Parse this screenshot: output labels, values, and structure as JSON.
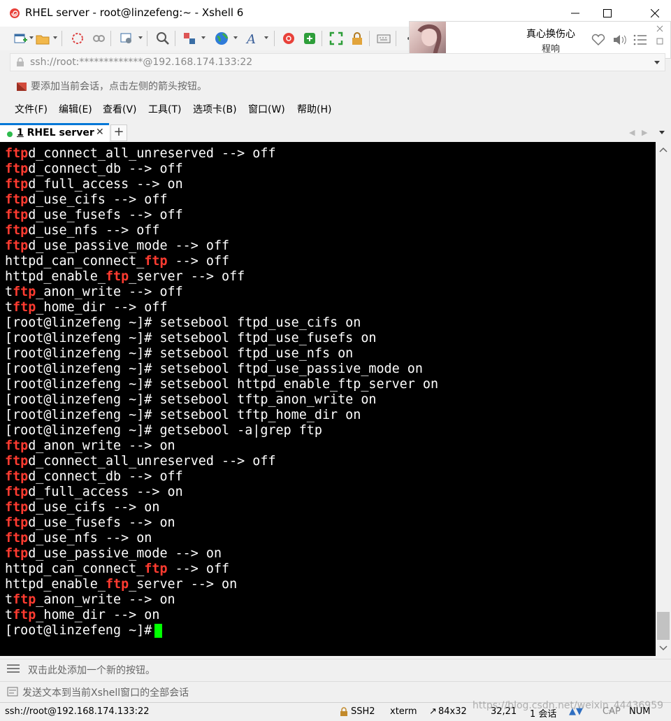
{
  "window": {
    "title": "RHEL server - root@linzefeng:~ - Xshell 6",
    "minimize_glyph": "—",
    "maximize_glyph": "☐",
    "close_glyph": "✕"
  },
  "music_player": {
    "song": "真心换伤心",
    "artist": "程响"
  },
  "address_bar": {
    "value": "ssh://root:*************@192.168.174.133:22"
  },
  "hint_bar": {
    "text": "要添加当前会话，点击左侧的箭头按钮。"
  },
  "menu": {
    "items": [
      "文件(F)",
      "编辑(E)",
      "查看(V)",
      "工具(T)",
      "选项卡(B)",
      "窗口(W)",
      "帮助(H)"
    ]
  },
  "tabs": {
    "active_number": "1",
    "active_label": " RHEL server",
    "close_glyph": "✕",
    "add_glyph": "+"
  },
  "terminal": {
    "lines": [
      [
        [
          "ftp",
          true
        ],
        [
          "d_connect_all_unreserved --> off",
          false
        ]
      ],
      [
        [
          "ftp",
          true
        ],
        [
          "d_connect_db --> off",
          false
        ]
      ],
      [
        [
          "ftp",
          true
        ],
        [
          "d_full_access --> on",
          false
        ]
      ],
      [
        [
          "ftp",
          true
        ],
        [
          "d_use_cifs --> off",
          false
        ]
      ],
      [
        [
          "ftp",
          true
        ],
        [
          "d_use_fusefs --> off",
          false
        ]
      ],
      [
        [
          "ftp",
          true
        ],
        [
          "d_use_nfs --> off",
          false
        ]
      ],
      [
        [
          "ftp",
          true
        ],
        [
          "d_use_passive_mode --> off",
          false
        ]
      ],
      [
        [
          "httpd_can_connect_",
          false
        ],
        [
          "ftp",
          true
        ],
        [
          " --> off",
          false
        ]
      ],
      [
        [
          "httpd_enable_",
          false
        ],
        [
          "ftp",
          true
        ],
        [
          "_server --> off",
          false
        ]
      ],
      [
        [
          "t",
          false
        ],
        [
          "ftp",
          true
        ],
        [
          "_anon_write --> off",
          false
        ]
      ],
      [
        [
          "t",
          false
        ],
        [
          "ftp",
          true
        ],
        [
          "_home_dir --> off",
          false
        ]
      ],
      [
        [
          "[root@linzefeng ~]# setsebool ftpd_use_cifs on",
          false
        ]
      ],
      [
        [
          "[root@linzefeng ~]# setsebool ftpd_use_fusefs on",
          false
        ]
      ],
      [
        [
          "[root@linzefeng ~]# setsebool ftpd_use_nfs on",
          false
        ]
      ],
      [
        [
          "[root@linzefeng ~]# setsebool ftpd_use_passive_mode on",
          false
        ]
      ],
      [
        [
          "[root@linzefeng ~]# setsebool httpd_enable_ftp_server on",
          false
        ]
      ],
      [
        [
          "[root@linzefeng ~]# setsebool tftp_anon_write on",
          false
        ]
      ],
      [
        [
          "[root@linzefeng ~]# setsebool tftp_home_dir on",
          false
        ]
      ],
      [
        [
          "[root@linzefeng ~]# getsebool -a|grep ftp",
          false
        ]
      ],
      [
        [
          "ftp",
          true
        ],
        [
          "d_anon_write --> on",
          false
        ]
      ],
      [
        [
          "ftp",
          true
        ],
        [
          "d_connect_all_unreserved --> off",
          false
        ]
      ],
      [
        [
          "ftp",
          true
        ],
        [
          "d_connect_db --> off",
          false
        ]
      ],
      [
        [
          "ftp",
          true
        ],
        [
          "d_full_access --> on",
          false
        ]
      ],
      [
        [
          "ftp",
          true
        ],
        [
          "d_use_cifs --> on",
          false
        ]
      ],
      [
        [
          "ftp",
          true
        ],
        [
          "d_use_fusefs --> on",
          false
        ]
      ],
      [
        [
          "ftp",
          true
        ],
        [
          "d_use_nfs --> on",
          false
        ]
      ],
      [
        [
          "ftp",
          true
        ],
        [
          "d_use_passive_mode --> on",
          false
        ]
      ],
      [
        [
          "httpd_can_connect_",
          false
        ],
        [
          "ftp",
          true
        ],
        [
          " --> off",
          false
        ]
      ],
      [
        [
          "httpd_enable_",
          false
        ],
        [
          "ftp",
          true
        ],
        [
          "_server --> on",
          false
        ]
      ],
      [
        [
          "t",
          false
        ],
        [
          "ftp",
          true
        ],
        [
          "_anon_write --> on",
          false
        ]
      ],
      [
        [
          "t",
          false
        ],
        [
          "ftp",
          true
        ],
        [
          "_home_dir --> on",
          false
        ]
      ]
    ],
    "prompt": "[root@linzefeng ~]#"
  },
  "quick_bar": {
    "text": "双击此处添加一个新的按钮。"
  },
  "compose_bar": {
    "text": "发送文本到当前Xshell窗口的全部会话"
  },
  "status": {
    "connection": "ssh://root@192.168.174.133:22",
    "protocol": "SSH2",
    "terminal_type": "xterm",
    "size": "84x32",
    "cursor_pos": "32,21",
    "sessions": "1 会话",
    "caps": "CAP",
    "num": "NUM"
  },
  "watermark": "https://blog.csdn.net/weixin_44436959",
  "colors": {
    "accent": "#0078d7",
    "terminal_bg": "#000000",
    "highlight": "#ff3b30",
    "cursor": "#00ff00"
  },
  "icons": [
    "app-snail-icon",
    "new-session-icon",
    "open-folder-icon",
    "connect-icon",
    "disconnect-icon",
    "properties-icon",
    "search-icon",
    "transfer-icon",
    "globe-icon",
    "font-icon",
    "xftp-icon",
    "xshell-icon",
    "fullscreen-icon",
    "lock-icon",
    "keyboard-icon",
    "heart-icon",
    "volume-icon",
    "playlist-icon",
    "shield-icon"
  ]
}
